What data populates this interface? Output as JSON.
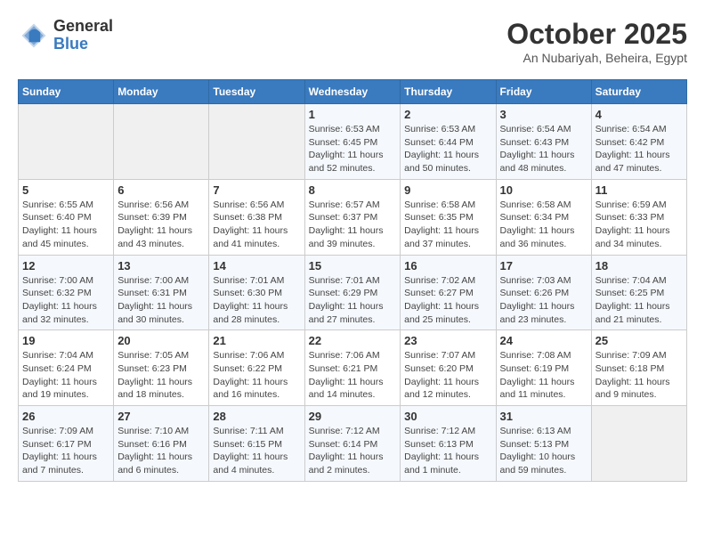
{
  "logo": {
    "general": "General",
    "blue": "Blue"
  },
  "header": {
    "month": "October 2025",
    "location": "An Nubariyah, Beheira, Egypt"
  },
  "weekdays": [
    "Sunday",
    "Monday",
    "Tuesday",
    "Wednesday",
    "Thursday",
    "Friday",
    "Saturday"
  ],
  "weeks": [
    [
      {
        "day": "",
        "info": ""
      },
      {
        "day": "",
        "info": ""
      },
      {
        "day": "",
        "info": ""
      },
      {
        "day": "1",
        "info": "Sunrise: 6:53 AM\nSunset: 6:45 PM\nDaylight: 11 hours\nand 52 minutes."
      },
      {
        "day": "2",
        "info": "Sunrise: 6:53 AM\nSunset: 6:44 PM\nDaylight: 11 hours\nand 50 minutes."
      },
      {
        "day": "3",
        "info": "Sunrise: 6:54 AM\nSunset: 6:43 PM\nDaylight: 11 hours\nand 48 minutes."
      },
      {
        "day": "4",
        "info": "Sunrise: 6:54 AM\nSunset: 6:42 PM\nDaylight: 11 hours\nand 47 minutes."
      }
    ],
    [
      {
        "day": "5",
        "info": "Sunrise: 6:55 AM\nSunset: 6:40 PM\nDaylight: 11 hours\nand 45 minutes."
      },
      {
        "day": "6",
        "info": "Sunrise: 6:56 AM\nSunset: 6:39 PM\nDaylight: 11 hours\nand 43 minutes."
      },
      {
        "day": "7",
        "info": "Sunrise: 6:56 AM\nSunset: 6:38 PM\nDaylight: 11 hours\nand 41 minutes."
      },
      {
        "day": "8",
        "info": "Sunrise: 6:57 AM\nSunset: 6:37 PM\nDaylight: 11 hours\nand 39 minutes."
      },
      {
        "day": "9",
        "info": "Sunrise: 6:58 AM\nSunset: 6:35 PM\nDaylight: 11 hours\nand 37 minutes."
      },
      {
        "day": "10",
        "info": "Sunrise: 6:58 AM\nSunset: 6:34 PM\nDaylight: 11 hours\nand 36 minutes."
      },
      {
        "day": "11",
        "info": "Sunrise: 6:59 AM\nSunset: 6:33 PM\nDaylight: 11 hours\nand 34 minutes."
      }
    ],
    [
      {
        "day": "12",
        "info": "Sunrise: 7:00 AM\nSunset: 6:32 PM\nDaylight: 11 hours\nand 32 minutes."
      },
      {
        "day": "13",
        "info": "Sunrise: 7:00 AM\nSunset: 6:31 PM\nDaylight: 11 hours\nand 30 minutes."
      },
      {
        "day": "14",
        "info": "Sunrise: 7:01 AM\nSunset: 6:30 PM\nDaylight: 11 hours\nand 28 minutes."
      },
      {
        "day": "15",
        "info": "Sunrise: 7:01 AM\nSunset: 6:29 PM\nDaylight: 11 hours\nand 27 minutes."
      },
      {
        "day": "16",
        "info": "Sunrise: 7:02 AM\nSunset: 6:27 PM\nDaylight: 11 hours\nand 25 minutes."
      },
      {
        "day": "17",
        "info": "Sunrise: 7:03 AM\nSunset: 6:26 PM\nDaylight: 11 hours\nand 23 minutes."
      },
      {
        "day": "18",
        "info": "Sunrise: 7:04 AM\nSunset: 6:25 PM\nDaylight: 11 hours\nand 21 minutes."
      }
    ],
    [
      {
        "day": "19",
        "info": "Sunrise: 7:04 AM\nSunset: 6:24 PM\nDaylight: 11 hours\nand 19 minutes."
      },
      {
        "day": "20",
        "info": "Sunrise: 7:05 AM\nSunset: 6:23 PM\nDaylight: 11 hours\nand 18 minutes."
      },
      {
        "day": "21",
        "info": "Sunrise: 7:06 AM\nSunset: 6:22 PM\nDaylight: 11 hours\nand 16 minutes."
      },
      {
        "day": "22",
        "info": "Sunrise: 7:06 AM\nSunset: 6:21 PM\nDaylight: 11 hours\nand 14 minutes."
      },
      {
        "day": "23",
        "info": "Sunrise: 7:07 AM\nSunset: 6:20 PM\nDaylight: 11 hours\nand 12 minutes."
      },
      {
        "day": "24",
        "info": "Sunrise: 7:08 AM\nSunset: 6:19 PM\nDaylight: 11 hours\nand 11 minutes."
      },
      {
        "day": "25",
        "info": "Sunrise: 7:09 AM\nSunset: 6:18 PM\nDaylight: 11 hours\nand 9 minutes."
      }
    ],
    [
      {
        "day": "26",
        "info": "Sunrise: 7:09 AM\nSunset: 6:17 PM\nDaylight: 11 hours\nand 7 minutes."
      },
      {
        "day": "27",
        "info": "Sunrise: 7:10 AM\nSunset: 6:16 PM\nDaylight: 11 hours\nand 6 minutes."
      },
      {
        "day": "28",
        "info": "Sunrise: 7:11 AM\nSunset: 6:15 PM\nDaylight: 11 hours\nand 4 minutes."
      },
      {
        "day": "29",
        "info": "Sunrise: 7:12 AM\nSunset: 6:14 PM\nDaylight: 11 hours\nand 2 minutes."
      },
      {
        "day": "30",
        "info": "Sunrise: 7:12 AM\nSunset: 6:13 PM\nDaylight: 11 hours\nand 1 minute."
      },
      {
        "day": "31",
        "info": "Sunrise: 6:13 AM\nSunset: 5:13 PM\nDaylight: 10 hours\nand 59 minutes."
      },
      {
        "day": "",
        "info": ""
      }
    ]
  ]
}
